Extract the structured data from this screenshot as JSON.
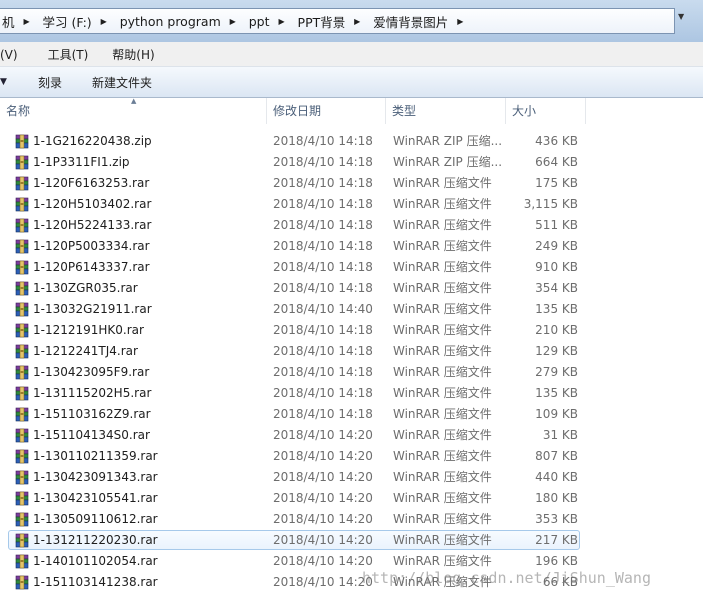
{
  "address_bar": {
    "crumbs": [
      "机",
      "学习 (F:)",
      "python program",
      "ppt",
      "PPT背景",
      "爱情背景图片"
    ]
  },
  "menu": {
    "view": "看(V)",
    "tools": "工具(T)",
    "help": "帮助(H)"
  },
  "command_bar": {
    "burn": "刻录",
    "new_folder": "新建文件夹"
  },
  "columns": {
    "name": "名称",
    "date": "修改日期",
    "type": "类型",
    "size": "大小"
  },
  "icons": {
    "file": "winrar-archive-icon",
    "sort": "sort-ascending-icon"
  },
  "files": [
    {
      "name": "1-1G216220438.zip",
      "date": "2018/4/10 14:18",
      "type": "WinRAR ZIP 压缩...",
      "size": "436 KB"
    },
    {
      "name": "1-1P3311FI1.zip",
      "date": "2018/4/10 14:18",
      "type": "WinRAR ZIP 压缩...",
      "size": "664 KB"
    },
    {
      "name": "1-120F6163253.rar",
      "date": "2018/4/10 14:18",
      "type": "WinRAR 压缩文件",
      "size": "175 KB"
    },
    {
      "name": "1-120H5103402.rar",
      "date": "2018/4/10 14:18",
      "type": "WinRAR 压缩文件",
      "size": "3,115 KB"
    },
    {
      "name": "1-120H5224133.rar",
      "date": "2018/4/10 14:18",
      "type": "WinRAR 压缩文件",
      "size": "511 KB"
    },
    {
      "name": "1-120P5003334.rar",
      "date": "2018/4/10 14:18",
      "type": "WinRAR 压缩文件",
      "size": "249 KB"
    },
    {
      "name": "1-120P6143337.rar",
      "date": "2018/4/10 14:18",
      "type": "WinRAR 压缩文件",
      "size": "910 KB"
    },
    {
      "name": "1-130ZGR035.rar",
      "date": "2018/4/10 14:18",
      "type": "WinRAR 压缩文件",
      "size": "354 KB"
    },
    {
      "name": "1-13032G21911.rar",
      "date": "2018/4/10 14:40",
      "type": "WinRAR 压缩文件",
      "size": "135 KB"
    },
    {
      "name": "1-1212191HK0.rar",
      "date": "2018/4/10 14:18",
      "type": "WinRAR 压缩文件",
      "size": "210 KB"
    },
    {
      "name": "1-1212241TJ4.rar",
      "date": "2018/4/10 14:18",
      "type": "WinRAR 压缩文件",
      "size": "129 KB"
    },
    {
      "name": "1-130423095F9.rar",
      "date": "2018/4/10 14:18",
      "type": "WinRAR 压缩文件",
      "size": "279 KB"
    },
    {
      "name": "1-131115202H5.rar",
      "date": "2018/4/10 14:18",
      "type": "WinRAR 压缩文件",
      "size": "135 KB"
    },
    {
      "name": "1-151103162Z9.rar",
      "date": "2018/4/10 14:18",
      "type": "WinRAR 压缩文件",
      "size": "109 KB"
    },
    {
      "name": "1-151104134S0.rar",
      "date": "2018/4/10 14:20",
      "type": "WinRAR 压缩文件",
      "size": "31 KB"
    },
    {
      "name": "1-130110211359.rar",
      "date": "2018/4/10 14:20",
      "type": "WinRAR 压缩文件",
      "size": "807 KB"
    },
    {
      "name": "1-130423091343.rar",
      "date": "2018/4/10 14:20",
      "type": "WinRAR 压缩文件",
      "size": "440 KB"
    },
    {
      "name": "1-130423105541.rar",
      "date": "2018/4/10 14:20",
      "type": "WinRAR 压缩文件",
      "size": "180 KB"
    },
    {
      "name": "1-130509110612.rar",
      "date": "2018/4/10 14:20",
      "type": "WinRAR 压缩文件",
      "size": "353 KB"
    },
    {
      "name": "1-131211220230.rar",
      "date": "2018/4/10 14:20",
      "type": "WinRAR 压缩文件",
      "size": "217 KB",
      "selected": true
    },
    {
      "name": "1-140101102054.rar",
      "date": "2018/4/10 14:20",
      "type": "WinRAR 压缩文件",
      "size": "196 KB"
    },
    {
      "name": "1-151103141238.rar",
      "date": "2018/4/10 14:20",
      "type": "WinRAR 压缩文件",
      "size": "66 KB"
    }
  ],
  "watermark": "http://blog.csdn.net/JiShun_Wang"
}
